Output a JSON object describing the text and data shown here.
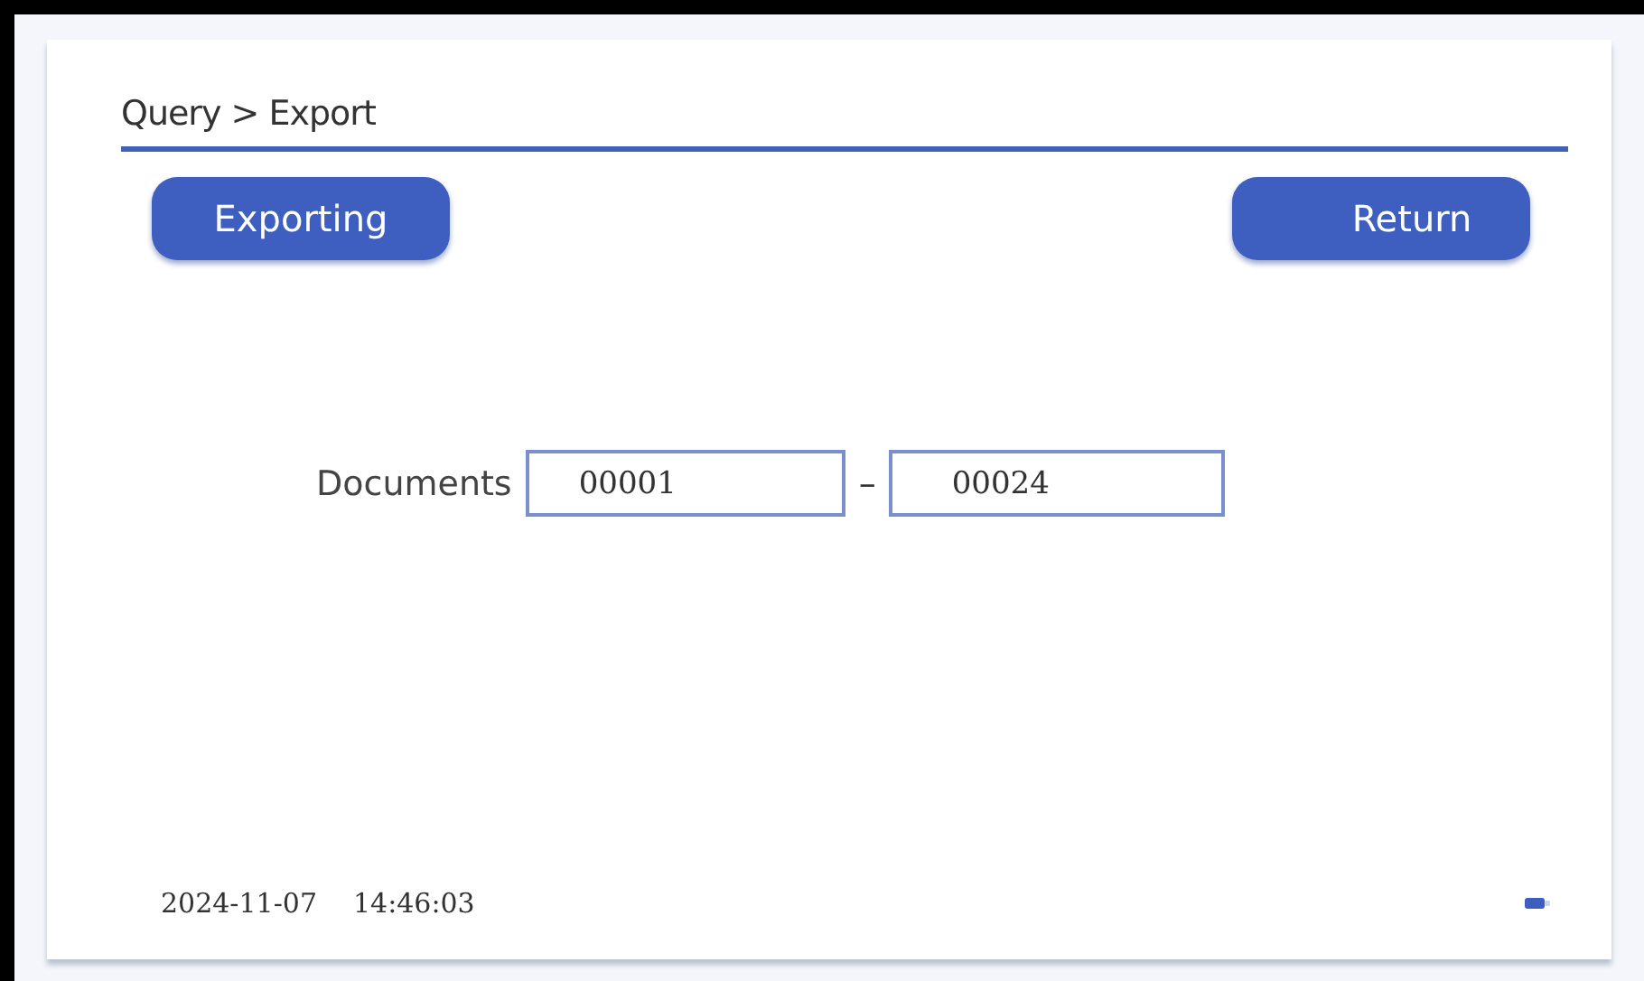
{
  "breadcrumb": "Query > Export",
  "buttons": [
    "Exporting",
    "Return"
  ],
  "range": {
    "label": "Documents",
    "from": "00001",
    "separator": "–",
    "to": "00024"
  },
  "status_bar": {
    "date": "2024-11-07",
    "time": "14:46:03"
  }
}
